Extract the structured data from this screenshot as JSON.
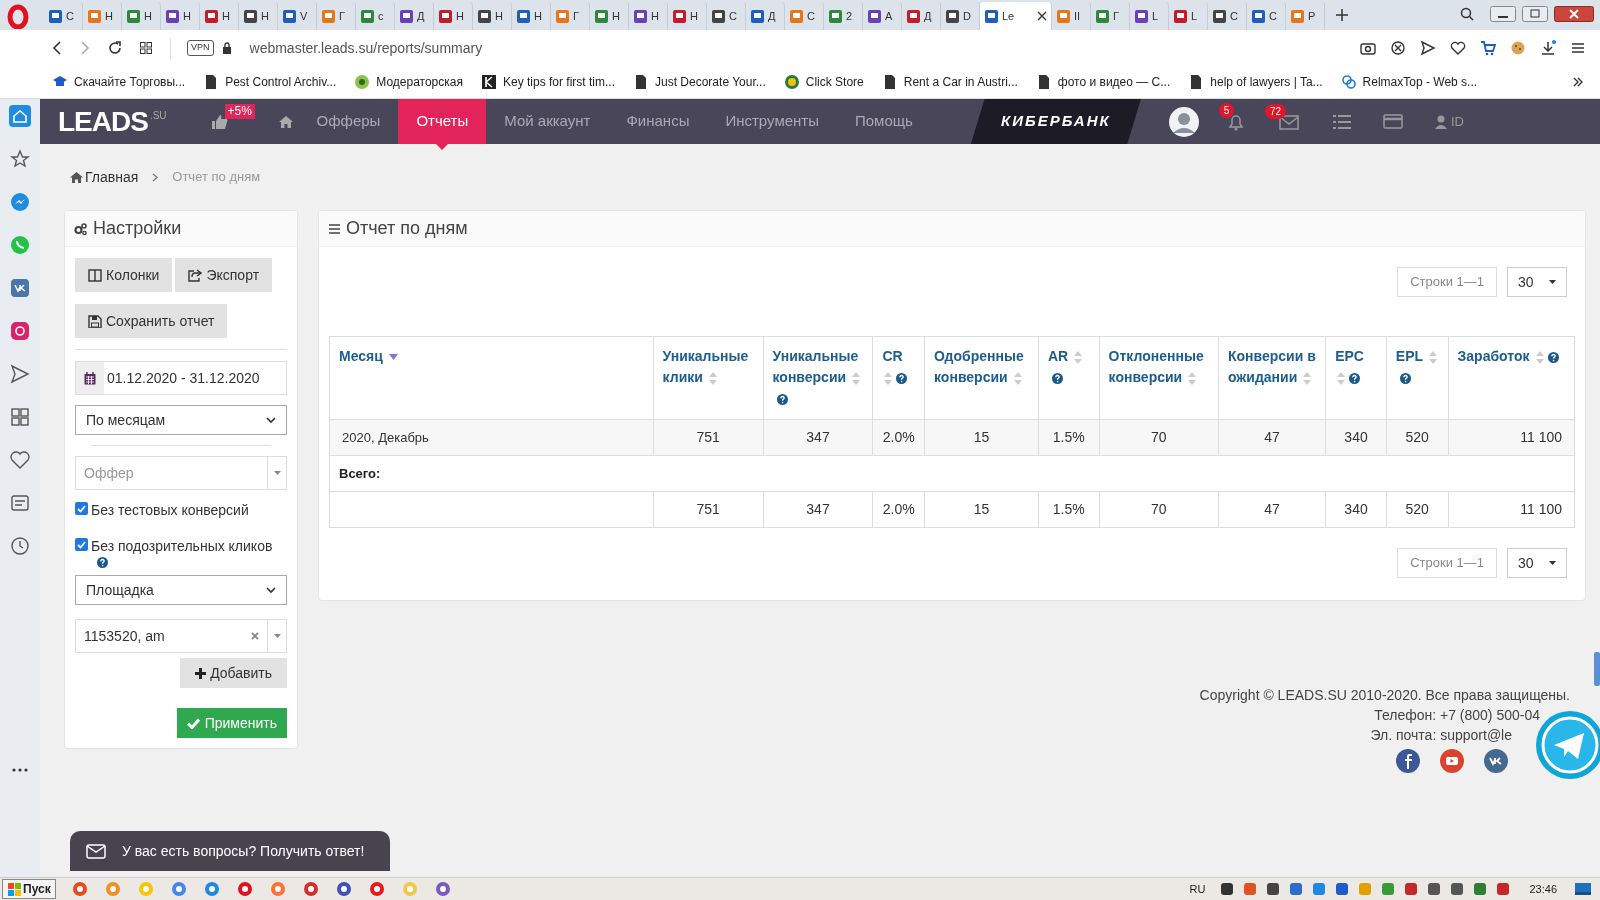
{
  "browser": {
    "tabs": [
      {
        "title": "С",
        "selected": false
      },
      {
        "title": "Н",
        "selected": false
      },
      {
        "title": "Н",
        "selected": false
      },
      {
        "title": "Н",
        "selected": false
      },
      {
        "title": "Н",
        "selected": false
      },
      {
        "title": "Н",
        "selected": false
      },
      {
        "title": "V",
        "selected": false
      },
      {
        "title": "Г",
        "selected": false
      },
      {
        "title": "с",
        "selected": false
      },
      {
        "title": "Д",
        "selected": false
      },
      {
        "title": "Н",
        "selected": false
      },
      {
        "title": "Н",
        "selected": false
      },
      {
        "title": "Н",
        "selected": false
      },
      {
        "title": "Г",
        "selected": false
      },
      {
        "title": "Н",
        "selected": false
      },
      {
        "title": "Н",
        "selected": false
      },
      {
        "title": "Н",
        "selected": false
      },
      {
        "title": "С",
        "selected": false
      },
      {
        "title": "Д",
        "selected": false
      },
      {
        "title": "С",
        "selected": false
      },
      {
        "title": "2",
        "selected": false
      },
      {
        "title": "А",
        "selected": false
      },
      {
        "title": "Д",
        "selected": false
      },
      {
        "title": "D",
        "selected": false
      },
      {
        "title": "Le",
        "selected": true
      },
      {
        "title": "II",
        "selected": false
      },
      {
        "title": "Г",
        "selected": false
      },
      {
        "title": "L",
        "selected": false
      },
      {
        "title": "L",
        "selected": false
      },
      {
        "title": "С",
        "selected": false
      },
      {
        "title": "С",
        "selected": false
      },
      {
        "title": "Р",
        "selected": false
      }
    ],
    "vpn": "VPN",
    "url": "webmaster.leads.su/reports/summary",
    "bookmarks": [
      "Скачайте Торговы...",
      "Pest Control Archiv...",
      "Модераторская",
      "Key tips for first tim...",
      "Just Decorate Your...",
      "Click Store",
      "Rent a Car in Austri...",
      "фото и видео — С...",
      "help of lawyers | Ta...",
      "RelmaxTop - Web s..."
    ]
  },
  "site": {
    "logo": "LEADS",
    "logo_suffix": ".SU",
    "like_badge": "+5%",
    "nav": [
      {
        "label": "Офферы",
        "selected": false
      },
      {
        "label": "Отчеты",
        "selected": true
      },
      {
        "label": "Мой аккаунт",
        "selected": false
      },
      {
        "label": "Финансы",
        "selected": false
      },
      {
        "label": "Инструменты",
        "selected": false
      },
      {
        "label": "Помощь",
        "selected": false
      }
    ],
    "banner": "КИБЕРБАНК",
    "notifications": "5",
    "messages": "72",
    "user": "ID"
  },
  "breadcrumb": [
    "Главная",
    "Отчет по дням"
  ],
  "settings": {
    "title": "Настройки",
    "buttons": [
      "Колонки",
      "Экспорт",
      "Сохранить отчет"
    ],
    "date_range": "01.12.2020 - 31.12.2020",
    "grouping": "По месяцам",
    "offer_placeholder": "Оффер",
    "checkboxes": [
      {
        "label": "Без тестовых конверсий",
        "checked": true,
        "help": false
      },
      {
        "label": "Без подозрительных кликов",
        "checked": true,
        "help": true
      }
    ],
    "source": "Площадка",
    "source_value": "1153520, am",
    "add_button": "Добавить",
    "apply_button": "Применить"
  },
  "report": {
    "title": "Отчет по дням",
    "pagers": [
      {
        "text": "Строки 1—1",
        "page_size": "30"
      },
      {
        "text": "Строки 1—1",
        "page_size": "30"
      }
    ],
    "columns": [
      {
        "label": "Месяц",
        "sorted": true,
        "help": false
      },
      {
        "label": "Уникальные клики",
        "sorted": false,
        "help": false
      },
      {
        "label": "Уникальные конверсии",
        "sorted": false,
        "help": true
      },
      {
        "label": "CR",
        "sorted": false,
        "help": true
      },
      {
        "label": "Одобренные конверсии",
        "sorted": false,
        "help": false
      },
      {
        "label": "AR",
        "sorted": false,
        "help": true
      },
      {
        "label": "Отклоненные конверсии",
        "sorted": false,
        "help": false
      },
      {
        "label": "Конверсии в ожидании",
        "sorted": false,
        "help": false
      },
      {
        "label": "EPC",
        "sorted": false,
        "help": true
      },
      {
        "label": "EPL",
        "sorted": false,
        "help": true
      },
      {
        "label": "Заработок",
        "sorted": false,
        "help": true
      }
    ],
    "rows": [
      [
        "2020, Декабрь",
        "751",
        "347",
        "2.0%",
        "15",
        "1.5%",
        "70",
        "47",
        "340",
        "520",
        "11 100"
      ]
    ],
    "total_label": "Всего:",
    "totals": [
      "751",
      "347",
      "2.0%",
      "15",
      "1.5%",
      "70",
      "47",
      "340",
      "520",
      "11 100"
    ]
  },
  "footer": {
    "copyright": "Copyright © LEADS.SU 2010-2020. Все права защищены.",
    "phone": "Телефон: +7 (800) 500-04",
    "email": "Эл. почта: support@le"
  },
  "chat": "У вас есть вопросы? Получить ответ!",
  "taskbar": {
    "start": "Пуск",
    "lang": "RU",
    "time": "23:46"
  }
}
